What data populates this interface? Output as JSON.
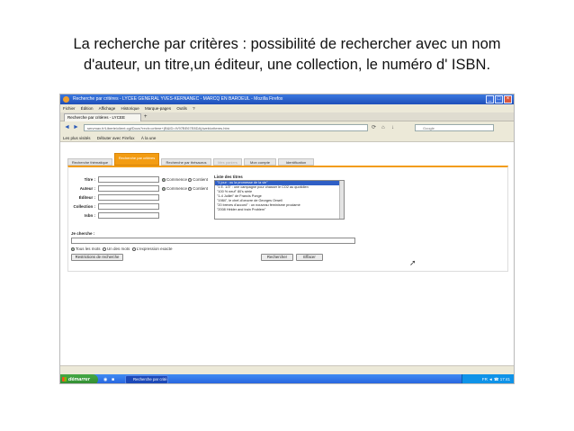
{
  "caption": {
    "line1": "La recherche par critères : possibilité de rechercher avec un nom",
    "line2": "d'auteur, un titre,un éditeur, une collection, le numéro d' ISBN."
  },
  "window": {
    "title": "Recherche par critères - LYCEE GENERAL YVES-KERNANEC - MARCQ EN BAROEUL - Mozilla Firefox",
    "controls": [
      "_",
      "□",
      "×"
    ]
  },
  "menubar": {
    "items": [
      "Fichier",
      "Édition",
      "Affichage",
      "Historique",
      "Marque-pages",
      "Outils",
      "?"
    ]
  },
  "browser_tab": {
    "label": "Recherche par critères - LYCEE GENERAL Y...",
    "new_tab": "+"
  },
  "navbar": {
    "back": "◄",
    "forward": "►",
    "url": "servmax.fr/Liberte/client.cgi/Docs?rech=critere+(B&ID=IV97BE67E8DA)/web/criteres.htm",
    "search_placeholder": "Google",
    "reload": "⟳",
    "home": "⌂",
    "download": "↓"
  },
  "bookmarks": {
    "items": [
      "Les plus visités",
      "Débuter avec Firefox",
      "À la une"
    ]
  },
  "site_tabs": [
    {
      "label": "Recherche thématique",
      "state": "normal"
    },
    {
      "label": "Recherche par critères",
      "state": "active"
    },
    {
      "label": "Recherche par thésaurus",
      "state": "normal"
    },
    {
      "label": "Mes paniers",
      "state": "disabled"
    },
    {
      "label": "Mon compte",
      "state": "normal"
    },
    {
      "label": "Identification",
      "state": "normal"
    }
  ],
  "form": {
    "fields": [
      {
        "label": "Titre :"
      },
      {
        "label": "Auteur :"
      },
      {
        "label": "Éditeur :"
      },
      {
        "label": "Collection :"
      },
      {
        "label": "Isbn :"
      }
    ],
    "radio_commence": "Commence",
    "radio_contient": "Contient",
    "list_title": "Liste des titres",
    "titles": [
      "\"1 jour : ou la promesse de la vie\"",
      "\"1 E. 1/3\" : une campagne pour chasser le CO2 au quotidien",
      "\"100 % neuf\" 80's série",
      "\"1-4 Juillet\" de Francis Ponge",
      "\"1984\", le chef-d'oeuvre de Georges Orwell",
      "\"20 brèves d'accord\" : un nouveau féminisme proclamé",
      "\"2008 Hélder and train Problem\""
    ],
    "jecherche_label": "Je cherche :",
    "word_options": [
      "Tous les mots",
      "Un des mots",
      "L'expression exacte"
    ],
    "restrict_button": "Restrictions de recherche",
    "search_button": "Rechercher",
    "clear_button": "Effacer"
  },
  "taskbar": {
    "start": "démarrer",
    "item": "Recherche par critè...",
    "clock": "FR  ◄  ☎  17:41"
  }
}
